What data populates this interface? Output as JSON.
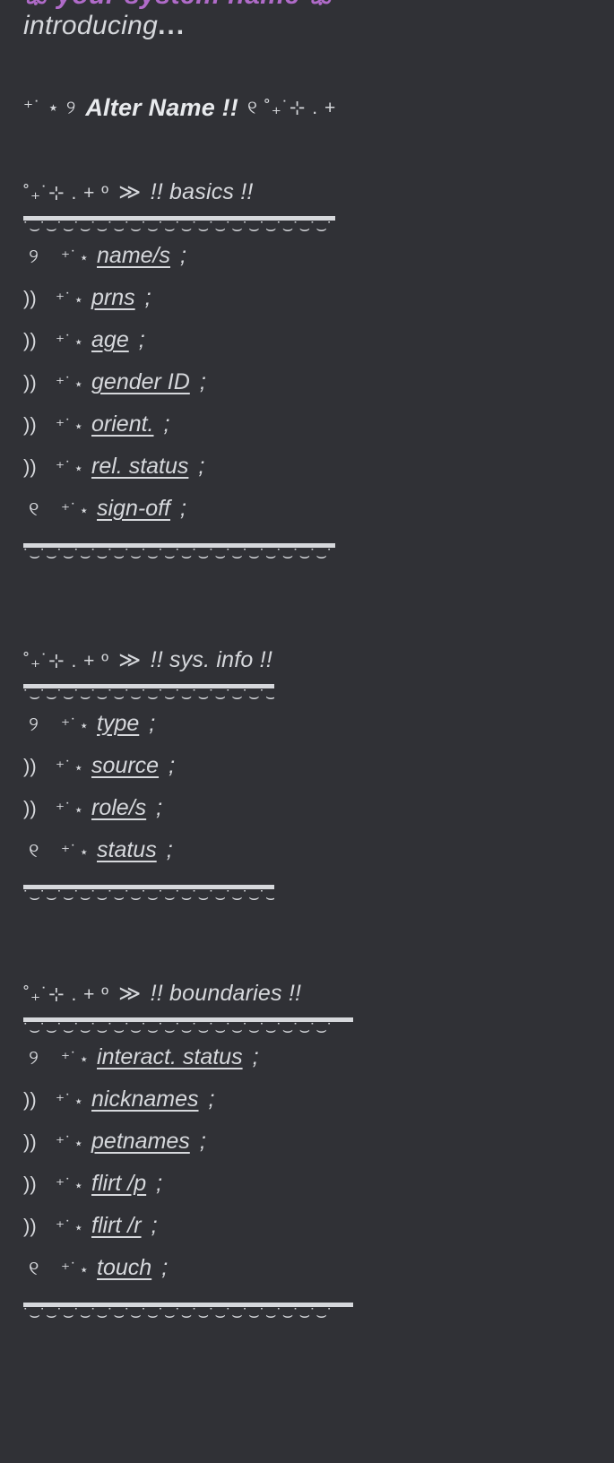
{
  "top_cut_line": "ꕥ your system name ꕥ",
  "intro": {
    "text": "introducing",
    "dots": "..."
  },
  "title": {
    "deco_left": "⁺˙ ⋆ ୨",
    "text": "Alter Name !!",
    "deco_right": "୧ ˚₊˙⊹ . +"
  },
  "decorations": {
    "header_prefix": "˚₊˙⊹ . + º",
    "header_arrow": "≫",
    "scallop": "˙⌣˙⌣˙⌣˙⌣˙⌣˙⌣˙⌣˙⌣˙⌣˙⌣˙⌣˙⌣˙⌣˙⌣˙⌣˙⌣˙⌣˙⌣˙",
    "lead_first": "୨",
    "lead_mid": "))",
    "lead_last": "୧",
    "spark": "⁺˙",
    "star": "⋆",
    "semicolon": ";"
  },
  "sections": [
    {
      "id": "basics",
      "title": "!! basics !!",
      "divider_width": "w1",
      "items": [
        {
          "label": "name/s"
        },
        {
          "label": "prns"
        },
        {
          "label": "age"
        },
        {
          "label": "gender ID"
        },
        {
          "label": "orient."
        },
        {
          "label": "rel. status"
        },
        {
          "label": "sign-off"
        }
      ]
    },
    {
      "id": "sysinfo",
      "title": "!! sys. info !!",
      "divider_width": "w2",
      "items": [
        {
          "label": "type"
        },
        {
          "label": "source"
        },
        {
          "label": "role/s"
        },
        {
          "label": "status"
        }
      ]
    },
    {
      "id": "boundaries",
      "title": "!! boundaries !!",
      "divider_width": "w3",
      "items": [
        {
          "label": "interact. status"
        },
        {
          "label": "nicknames"
        },
        {
          "label": "petnames"
        },
        {
          "label": "flirt /p"
        },
        {
          "label": "flirt /r"
        },
        {
          "label": "touch"
        }
      ]
    }
  ],
  "colors": {
    "background": "#303136",
    "text": "#d6d8dc",
    "accent_purple": "#b06bc9"
  }
}
